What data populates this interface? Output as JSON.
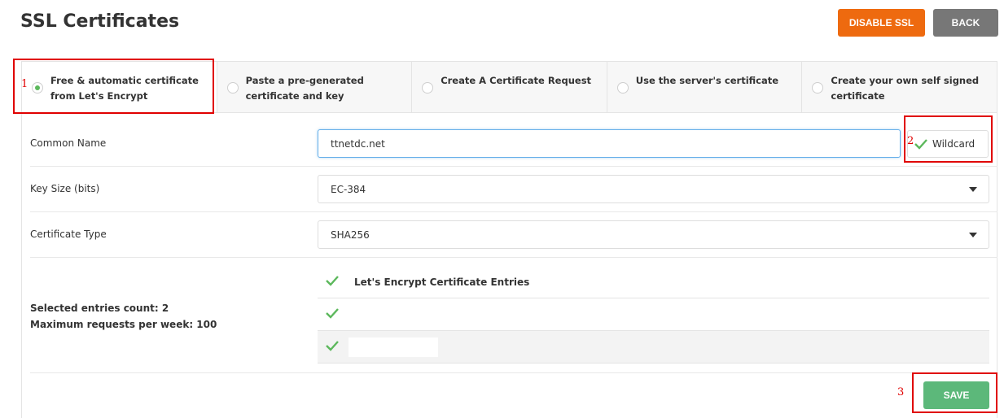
{
  "header": {
    "title": "SSL Certificates",
    "disable_ssl_label": "DISABLE SSL",
    "back_label": "BACK"
  },
  "tabs": [
    {
      "label": "Free & automatic certificate from Let's Encrypt",
      "selected": true
    },
    {
      "label": "Paste a pre-generated certificate and key",
      "selected": false
    },
    {
      "label": "Create A Certificate Request",
      "selected": false
    },
    {
      "label": "Use the server's certificate",
      "selected": false
    },
    {
      "label": "Create your own self signed certificate",
      "selected": false
    }
  ],
  "form": {
    "common_name": {
      "label": "Common Name",
      "value": "ttnetdc.net"
    },
    "wildcard": {
      "label": "Wildcard",
      "checked": true
    },
    "key_size": {
      "label": "Key Size (bits)",
      "value": "EC-384"
    },
    "certificate_type": {
      "label": "Certificate Type",
      "value": "SHA256"
    },
    "entries": {
      "header_label": "Let's Encrypt Certificate Entries",
      "items": [
        {
          "label": "",
          "checked": true
        },
        {
          "label": "",
          "checked": true
        }
      ]
    },
    "stats": {
      "selected_count": "Selected entries count: 2",
      "max_requests": "Maximum requests per week: 100"
    },
    "save_label": "SAVE"
  },
  "annotations": [
    "1",
    "2",
    "3"
  ],
  "colors": {
    "accent_green": "#5cb85c",
    "disable_orange": "#ee6a0f",
    "back_gray": "#777777",
    "annotation_red": "#e00000"
  },
  "icons": {
    "checkmark": "check-icon",
    "dropdown": "caret-down-icon",
    "radio": "radio-icon"
  }
}
